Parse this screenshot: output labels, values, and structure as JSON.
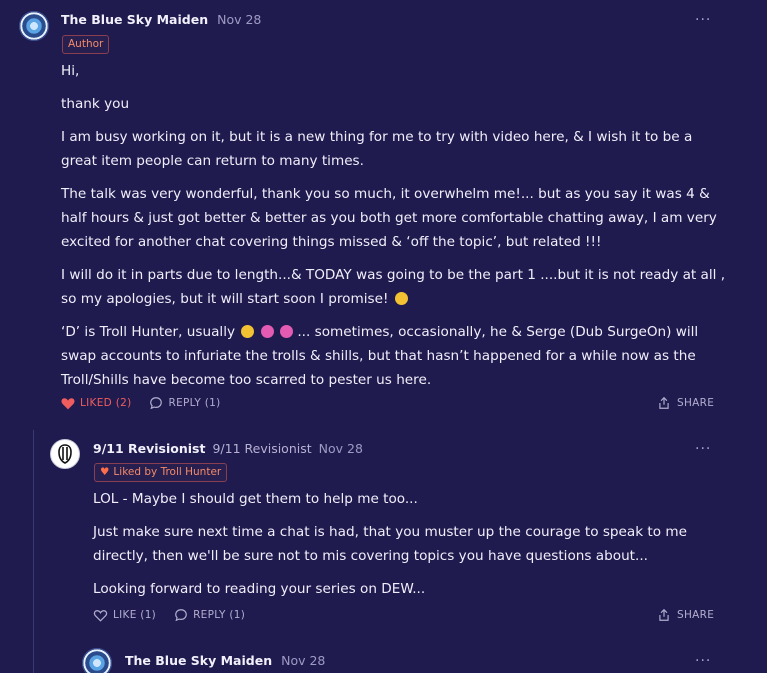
{
  "comments": [
    {
      "author": "The Blue Sky Maiden",
      "date": "Nov 28",
      "badge": "Author",
      "paragraphs": [
        "Hi,",
        "thank you",
        "I am busy working on it, but it is a new thing for me to try with video here, & I wish it to be a great item people can return to many times.",
        "The talk was very wonderful, thank you so much, it overwhelm me!... but as you say it was 4 & half hours & just got better & better as you both get more comfortable chatting away, I am very excited for another chat covering things missed & ‘off the topic’, but related !!!",
        "I will do it in parts due to length...& TODAY was going to be the part 1 ....but it is not ready at all , so my apologies, but it will start soon I promise!",
        "‘D’ is Troll Hunter, usually",
        "... sometimes, occasionally, he & Serge (Dub SurgeOn) will swap accounts to infuriate the trolls & shills, but that hasn’t happened for a while now as the Troll/Shills have become too scarred to pester us here."
      ],
      "like_label": "LIKED (2)",
      "reply_label": "REPLY (1)",
      "share_label": "SHARE"
    },
    {
      "author": "9/11 Revisionist",
      "display_name": "9/11 Revisionist",
      "date": "Nov 28",
      "badge": "Liked by Troll Hunter",
      "paragraphs": [
        "LOL - Maybe I should get them to help me too...",
        "Just make sure next time a chat is had, that you muster up the courage to speak to me directly, then we'll be sure not to mis covering topics you have questions about...",
        "Looking forward to reading your series on DEW..."
      ],
      "like_label": "LIKE (1)",
      "reply_label": "REPLY (1)",
      "share_label": "SHARE"
    },
    {
      "author": "The Blue Sky Maiden",
      "date": "Nov 28"
    }
  ],
  "more_icon": "···",
  "icons": {
    "more": "more-horizontal-icon",
    "like": "heart-icon",
    "reply": "speech-bubble-icon",
    "share": "share-icon"
  },
  "colors": {
    "background": "#1f1b4e",
    "liked": "#ef5d5f",
    "badge_text": "#f58a69"
  }
}
